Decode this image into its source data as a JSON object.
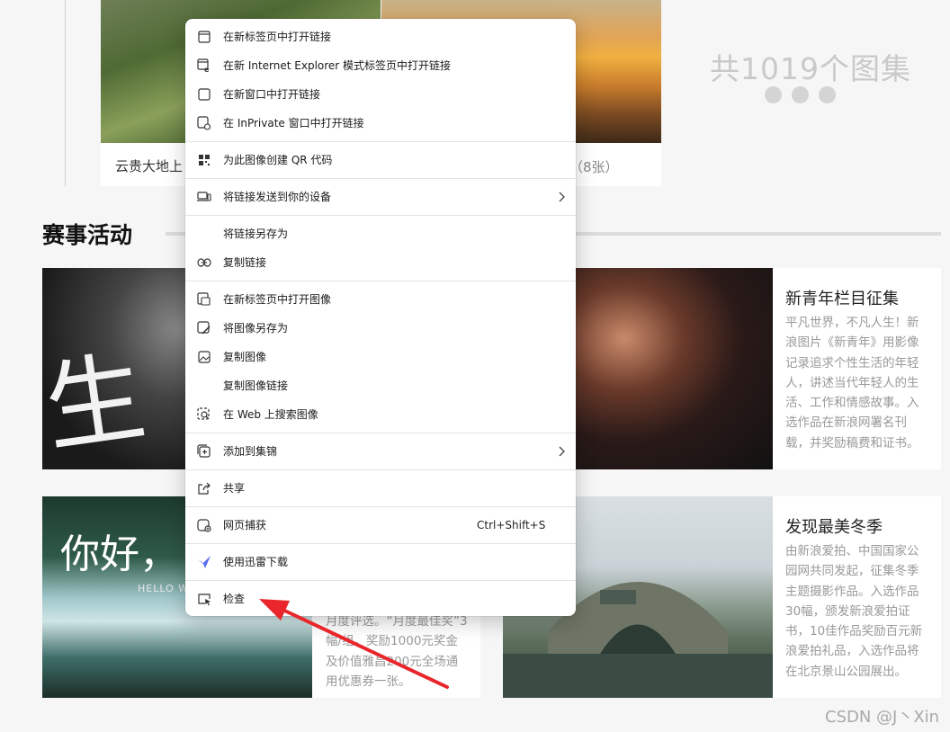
{
  "gallery": {
    "left_caption": "云贵大地上",
    "right_count": "藏（8张）",
    "total": "共1019个图集"
  },
  "section": {
    "title": "赛事活动"
  },
  "cards": [
    {
      "title": "新青年栏目征集",
      "desc": "平凡世界，不凡人生！新浪图片《新青年》用影像记录追求个性生活的年轻人，讲述当代年轻人的生活、工作和情感故事。入选作品在新浪网署名刊载，并奖励稿费和证书。"
    },
    {
      "desc": "月度评选。“月度最佳奖”3幅/组，奖励1000元奖金及价值雅昌200元全场通用优惠券一张。"
    },
    {
      "title": "发现最美冬季",
      "desc": "由新浪爱拍、中国国家公园网共同发起，征集冬季主题摄影作品。入选作品30幅，颁发新浪爱拍证书，10佳作品奖励百元新浪爱拍礼品，入选作品将在北京景山公园展出。"
    }
  ],
  "images": {
    "card1_text": "生",
    "card3_text": "你好，",
    "card3_sub": "HELLO W"
  },
  "context_menu": {
    "items": [
      {
        "label": "在新标签页中打开链接",
        "icon": "new-tab-icon"
      },
      {
        "label": "在新 Internet Explorer 模式标签页中打开链接",
        "icon": "ie-mode-icon"
      },
      {
        "label": "在新窗口中打开链接",
        "icon": "new-window-icon"
      },
      {
        "label": "在 InPrivate 窗口中打开链接",
        "icon": "inprivate-icon"
      },
      {
        "label": "为此图像创建 QR 代码",
        "icon": "qr-code-icon"
      },
      {
        "label": "将链接发送到你的设备",
        "icon": "send-to-device-icon"
      },
      {
        "label": "将链接另存为",
        "icon": ""
      },
      {
        "label": "复制链接",
        "icon": "link-icon"
      },
      {
        "label": "在新标签页中打开图像",
        "icon": "open-image-icon"
      },
      {
        "label": "将图像另存为",
        "icon": "save-image-icon"
      },
      {
        "label": "复制图像",
        "icon": "copy-image-icon"
      },
      {
        "label": "复制图像链接",
        "icon": ""
      },
      {
        "label": "在 Web 上搜索图像",
        "icon": "visual-search-icon"
      },
      {
        "label": "添加到集锦",
        "icon": "collections-icon"
      },
      {
        "label": "共享",
        "icon": "share-icon"
      },
      {
        "label": "网页捕获",
        "icon": "web-capture-icon",
        "shortcut": "Ctrl+Shift+S"
      },
      {
        "label": "使用迅雷下载",
        "icon": "thunder-download-icon"
      },
      {
        "label": "检查",
        "icon": "inspect-icon"
      }
    ]
  },
  "watermark": "CSDN @J丶Xin",
  "colors": {
    "annotation_arrow": "#e8262b",
    "thunder_icon": "#5a6cf0"
  }
}
